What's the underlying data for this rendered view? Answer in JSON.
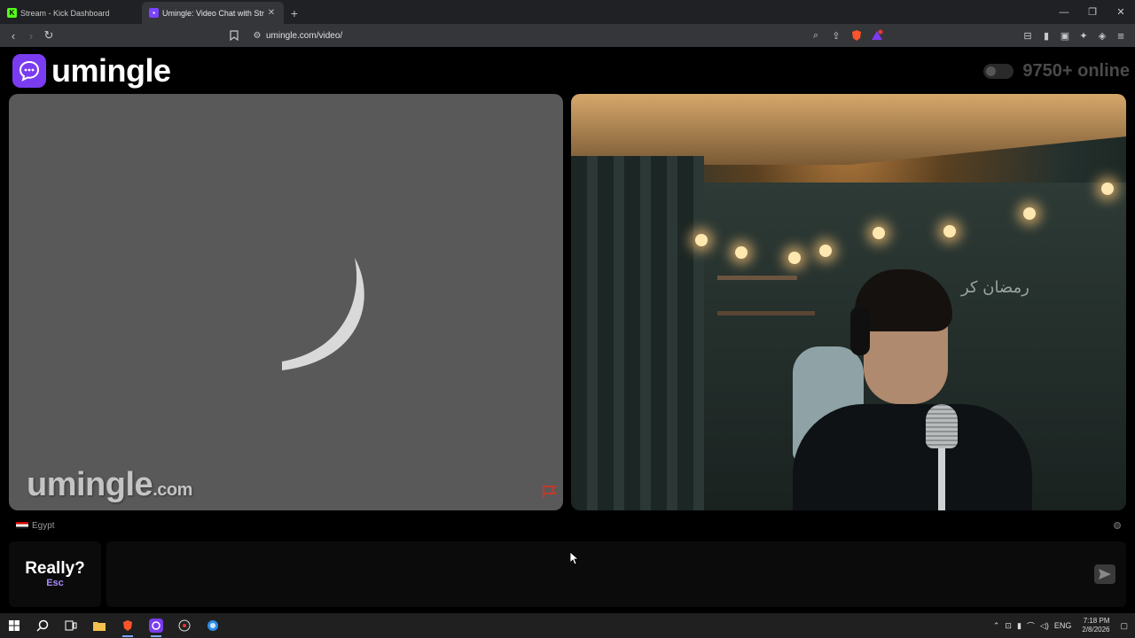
{
  "browser": {
    "tabs": [
      {
        "title": "Stream - Kick Dashboard",
        "active": false
      },
      {
        "title": "Umingle: Video Chat with Str",
        "active": true
      }
    ],
    "url": "umingle.com/video/"
  },
  "site": {
    "logo_text": "umingle",
    "online_count": "9750+ online"
  },
  "left_video": {
    "watermark_main": "umingle",
    "watermark_suffix": ".com",
    "state": "loading"
  },
  "right_video": {
    "wall_text": "رمضان كر"
  },
  "partner": {
    "country": "Egypt"
  },
  "chat": {
    "esc_label": "Really?",
    "esc_key": "Esc",
    "input_value": ""
  },
  "taskbar": {
    "language": "ENG",
    "time": "7:18 PM",
    "date": "2/8/2026"
  },
  "colors": {
    "brand": "#7a3cf0",
    "esc_key": "#a78bfa"
  }
}
